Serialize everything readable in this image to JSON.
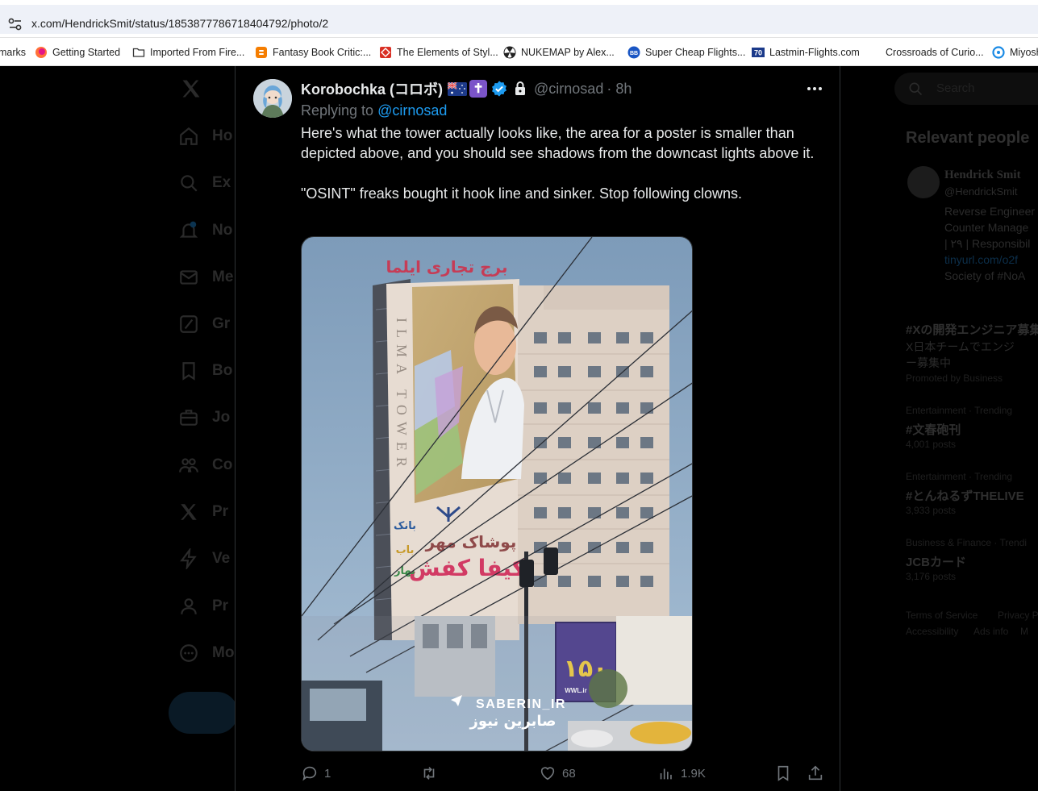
{
  "browser": {
    "url": "x.com/HendrickSmit/status/1853877786718404792/photo/2",
    "bookmarks": [
      {
        "label": "marks",
        "icon": "none"
      },
      {
        "label": "Getting Started",
        "icon": "firefox-icon"
      },
      {
        "label": "Imported From Fire...",
        "icon": "folder-icon"
      },
      {
        "label": "Fantasy Book Critic:...",
        "icon": "blogger-icon"
      },
      {
        "label": "The Elements of Styl...",
        "icon": "red-diamond-icon"
      },
      {
        "label": "NUKEMAP by Alex...",
        "icon": "radiation-icon"
      },
      {
        "label": "Super Cheap Flights...",
        "icon": "bb-icon"
      },
      {
        "label": "Lastmin-Flights.com",
        "icon": "70-icon"
      },
      {
        "label": "Crossroads of Curio...",
        "icon": "none"
      },
      {
        "label": "Miyosh",
        "icon": "circle-icon"
      }
    ]
  },
  "left_nav": {
    "items": [
      "Ho",
      "Ex",
      "No",
      "Me",
      "Gr",
      "Bo",
      "Jo",
      "Co",
      "Pr",
      "Ve",
      "Pr",
      "Mo"
    ]
  },
  "right_col": {
    "search_placeholder": "Search",
    "relevant_people_title": "Relevant people",
    "person_name": "Hendrick Smit",
    "person_handle": "@HendrickSmit",
    "bio_lines": [
      "Reverse Engineer",
      "Counter Manage",
      "| ٢٩ | Responsibil",
      "tinyurl.com/o2f",
      "Society of #NoA"
    ],
    "trends": [
      {
        "title": "#Xの開発エンジニア募集",
        "line1": "X日本チームでエンジ",
        "line2": "ー募集中",
        "meta": "Promoted by Business"
      },
      {
        "meta": "Entertainment · Trending",
        "title": "#文春砲刊",
        "count": "4,001 posts"
      },
      {
        "meta": "Entertainment · Trending",
        "title": "#とんねるずTHELIVE",
        "count": "3,933 posts"
      },
      {
        "meta": "Business & Finance · Trendi",
        "title": "JCBカード",
        "count": "3,176 posts"
      }
    ],
    "footer": [
      "Terms of Service",
      "Privacy P",
      "Accessibility",
      "Ads info",
      "M"
    ]
  },
  "tweet": {
    "display_name": "Korobochka (コロボ)",
    "handle": "@cirnosad",
    "time": "· 8h",
    "replying_prefix": "Replying to",
    "replying_to": "@cirnosad",
    "text_para1": "Here's what the tower actually looks like, the area for a poster is smaller than depicted above, and you should see shadows from the downcast lights above it.",
    "text_para2": "\"OSINT\" freaks bought it hook line and sinker. Stop following clowns.",
    "media": {
      "tower_vertical_text": "ILMA TOWER",
      "rooftop_sign": "برج تجاری ایلما",
      "sign_line1": "پوشاک مهر",
      "sign_line2": "کیفا کفش",
      "side_word1": "بانک",
      "side_word2": "باب",
      "side_word3": "بهار",
      "billboard_number": "۱۵۰",
      "billboard_site": "WWL.ir",
      "watermark": "SABERIN_IR",
      "watermark_fa": "صابرین نیوز"
    },
    "stats": {
      "replies": "1",
      "reposts": "",
      "likes": "68",
      "views": "1.9K"
    }
  },
  "colors": {
    "text_primary": "#e7e9ea",
    "text_secondary": "#71767b",
    "link": "#1d9bf0",
    "background": "#000000"
  }
}
